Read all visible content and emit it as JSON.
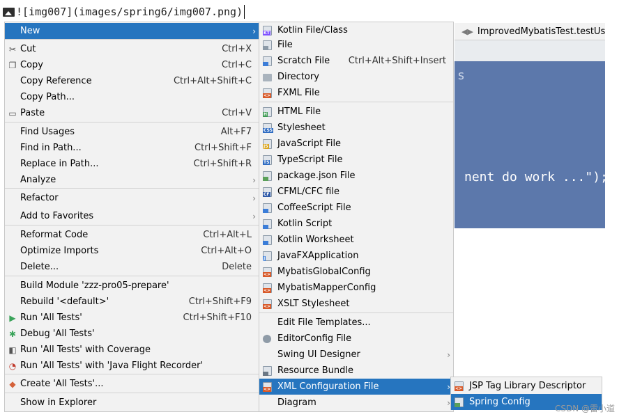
{
  "markdown": {
    "text": "![img007](images/spring6/img007.png)"
  },
  "context_menu": [
    {
      "label": "New",
      "shortcut": "",
      "icon": "",
      "submenu": true,
      "selected": true
    },
    {
      "label": "Cut",
      "shortcut": "Ctrl+X",
      "icon": "scissors-icon"
    },
    {
      "label": "Copy",
      "shortcut": "Ctrl+C",
      "icon": "copy-icon"
    },
    {
      "label": "Copy Reference",
      "shortcut": "Ctrl+Alt+Shift+C",
      "icon": ""
    },
    {
      "label": "Copy Path...",
      "shortcut": "",
      "icon": ""
    },
    {
      "label": "Paste",
      "shortcut": "Ctrl+V",
      "icon": "paste-icon"
    },
    {
      "label": "Find Usages",
      "shortcut": "Alt+F7",
      "icon": ""
    },
    {
      "label": "Find in Path...",
      "shortcut": "Ctrl+Shift+F",
      "icon": ""
    },
    {
      "label": "Replace in Path...",
      "shortcut": "Ctrl+Shift+R",
      "icon": ""
    },
    {
      "label": "Analyze",
      "shortcut": "",
      "icon": "",
      "submenu": true
    },
    {
      "label": "Refactor",
      "shortcut": "",
      "icon": "",
      "submenu": true
    },
    {
      "label": "Add to Favorites",
      "shortcut": "",
      "icon": "",
      "submenu": true
    },
    {
      "label": "Reformat Code",
      "shortcut": "Ctrl+Alt+L",
      "icon": ""
    },
    {
      "label": "Optimize Imports",
      "shortcut": "Ctrl+Alt+O",
      "icon": ""
    },
    {
      "label": "Delete...",
      "shortcut": "Delete",
      "icon": ""
    },
    {
      "label": "Build Module 'zzz-pro05-prepare'",
      "shortcut": "",
      "icon": ""
    },
    {
      "label": "Rebuild '<default>'",
      "shortcut": "Ctrl+Shift+F9",
      "icon": ""
    },
    {
      "label": "Run 'All Tests'",
      "shortcut": "Ctrl+Shift+F10",
      "icon": "run-icon"
    },
    {
      "label": "Debug 'All Tests'",
      "shortcut": "",
      "icon": "debug-icon"
    },
    {
      "label": "Run 'All Tests' with Coverage",
      "shortcut": "",
      "icon": "coverage-icon"
    },
    {
      "label": "Run 'All Tests' with 'Java Flight Recorder'",
      "shortcut": "",
      "icon": "flight-recorder-icon"
    },
    {
      "label": "Create 'All Tests'...",
      "shortcut": "",
      "icon": "create-tests-icon"
    },
    {
      "label": "Show in Explorer",
      "shortcut": "",
      "icon": ""
    }
  ],
  "new_submenu": [
    {
      "label": "Kotlin File/Class",
      "shortcut": "",
      "icon": "kotlin-file-icon"
    },
    {
      "label": "File",
      "shortcut": "",
      "icon": "file-icon"
    },
    {
      "label": "Scratch File",
      "shortcut": "Ctrl+Alt+Shift+Insert",
      "icon": "scratch-file-icon"
    },
    {
      "label": "Directory",
      "shortcut": "",
      "icon": "folder-icon"
    },
    {
      "label": "FXML File",
      "shortcut": "",
      "icon": "fxml-file-icon"
    },
    {
      "label": "HTML File",
      "shortcut": "",
      "icon": "html-file-icon"
    },
    {
      "label": "Stylesheet",
      "shortcut": "",
      "icon": "css-file-icon"
    },
    {
      "label": "JavaScript File",
      "shortcut": "",
      "icon": "javascript-file-icon"
    },
    {
      "label": "TypeScript File",
      "shortcut": "",
      "icon": "typescript-file-icon"
    },
    {
      "label": "package.json File",
      "shortcut": "",
      "icon": "package-json-icon"
    },
    {
      "label": "CFML/CFC file",
      "shortcut": "",
      "icon": "cfml-file-icon"
    },
    {
      "label": "CoffeeScript File",
      "shortcut": "",
      "icon": "coffeescript-file-icon"
    },
    {
      "label": "Kotlin Script",
      "shortcut": "",
      "icon": "kotlin-script-icon"
    },
    {
      "label": "Kotlin Worksheet",
      "shortcut": "",
      "icon": "kotlin-worksheet-icon"
    },
    {
      "label": "JavaFXApplication",
      "shortcut": "",
      "icon": "javafx-icon"
    },
    {
      "label": "MybatisGlobalConfig",
      "shortcut": "",
      "icon": "xml-file-icon"
    },
    {
      "label": "MybatisMapperConfig",
      "shortcut": "",
      "icon": "xml-file-icon"
    },
    {
      "label": "XSLT Stylesheet",
      "shortcut": "",
      "icon": "xslt-file-icon"
    },
    {
      "label": "Edit File Templates...",
      "shortcut": "",
      "icon": ""
    },
    {
      "label": "EditorConfig File",
      "shortcut": "",
      "icon": "gear-icon"
    },
    {
      "label": "Swing UI Designer",
      "shortcut": "",
      "icon": "",
      "submenu": true
    },
    {
      "label": "Resource Bundle",
      "shortcut": "",
      "icon": "resource-bundle-icon"
    },
    {
      "label": "XML Configuration File",
      "shortcut": "",
      "icon": "xml-file-icon",
      "submenu": true,
      "selected": true
    },
    {
      "label": "Diagram",
      "shortcut": "",
      "icon": "",
      "submenu": true
    }
  ],
  "xml_submenu": [
    {
      "label": "JSP Tag Library Descriptor",
      "icon": "xml-file-icon"
    },
    {
      "label": "Spring Config",
      "icon": "spring-config-icon",
      "selected": true
    }
  ],
  "editor": {
    "tab_label": "ImprovedMybatisTest.testUsrI",
    "code_line": "nent do work ...\");",
    "code_fragment": "s"
  },
  "watermark": "CSDN @雷小道",
  "colors": {
    "selection": "#2675bf",
    "menu_bg": "#f2f2f2",
    "editor_bg": "#5c78ab"
  }
}
